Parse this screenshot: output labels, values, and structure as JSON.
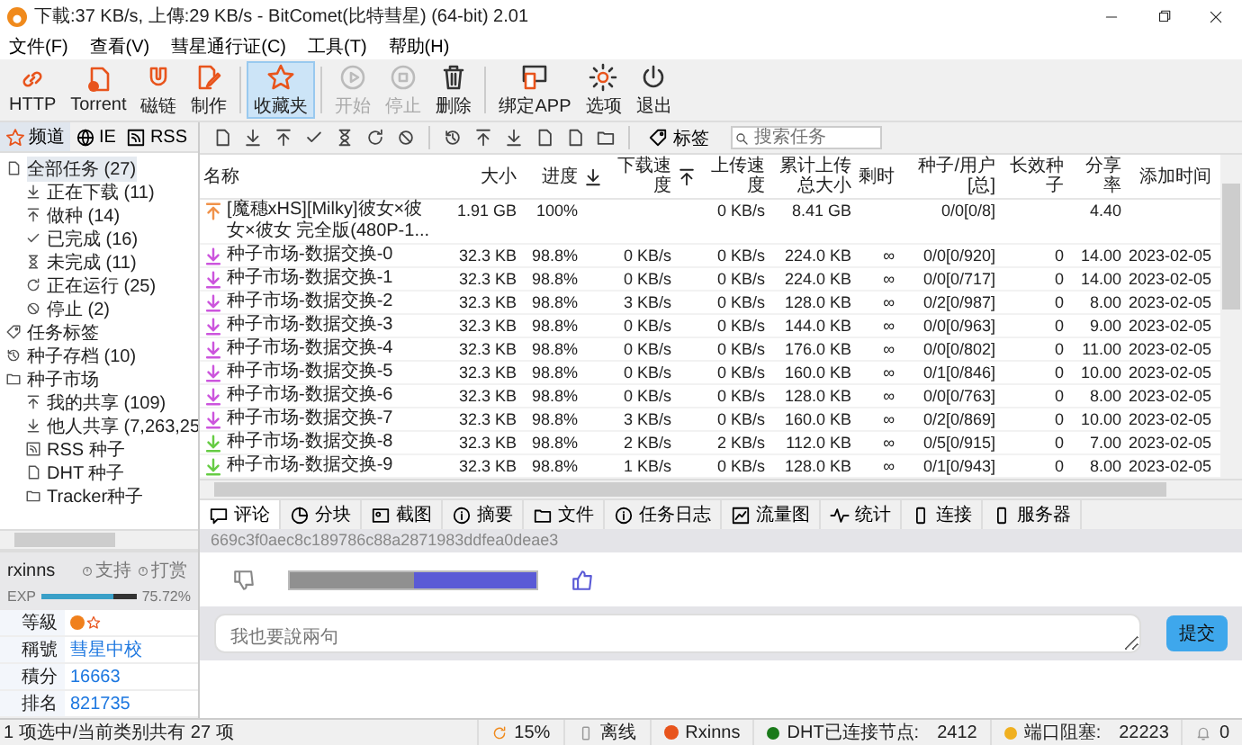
{
  "window": {
    "title": "下載:37 KB/s, 上傳:29 KB/s - BitComet(比特彗星) (64-bit) 2.01"
  },
  "menu": [
    "文件(F)",
    "查看(V)",
    "彗星通行证(C)",
    "工具(T)",
    "帮助(H)"
  ],
  "toolbar_groups": [
    [
      {
        "label": "HTTP",
        "selected": false,
        "disabled": false
      },
      {
        "label": "Torrent",
        "selected": false,
        "disabled": false
      },
      {
        "label": "磁链",
        "selected": false,
        "disabled": false
      },
      {
        "label": "制作",
        "selected": false,
        "disabled": false
      }
    ],
    [
      {
        "label": "收藏夹",
        "selected": true,
        "disabled": false
      }
    ],
    [
      {
        "label": "开始",
        "selected": false,
        "disabled": true
      },
      {
        "label": "停止",
        "selected": false,
        "disabled": true
      },
      {
        "label": "删除",
        "selected": false,
        "disabled": false
      }
    ],
    [
      {
        "label": "绑定APP",
        "selected": false,
        "disabled": false
      },
      {
        "label": "选项",
        "selected": false,
        "disabled": false
      },
      {
        "label": "退出",
        "selected": false,
        "disabled": false
      }
    ]
  ],
  "filter_bar": {
    "tag_button": "标签",
    "search": {
      "placeholder": "搜索任务"
    }
  },
  "sidebar": {
    "tabs": [
      {
        "label": "频道",
        "selected": true
      },
      {
        "label": "IE",
        "selected": false
      },
      {
        "label": "RSS",
        "selected": false
      }
    ],
    "tree": [
      {
        "label": "全部任务 (27)",
        "selected": true,
        "children": [
          {
            "label": "正在下载 (11)",
            "selected": false
          },
          {
            "label": "做种 (14)",
            "selected": false
          },
          {
            "label": "已完成 (16)",
            "selected": false
          },
          {
            "label": "未完成 (11)",
            "selected": false
          },
          {
            "label": "正在运行 (25)",
            "selected": false
          },
          {
            "label": "停止 (2)",
            "selected": false
          }
        ]
      },
      {
        "label": "任务标签",
        "selected": false
      },
      {
        "label": "种子存档 (10)",
        "selected": false
      },
      {
        "label": "种子市场",
        "selected": false,
        "children": [
          {
            "label": "我的共享 (109)",
            "selected": false
          },
          {
            "label": "他人共享 (7,263,25",
            "selected": false
          },
          {
            "label": "RSS 种子",
            "selected": false
          },
          {
            "label": "DHT 种子",
            "selected": false
          },
          {
            "label": "Tracker种子",
            "selected": false
          }
        ]
      }
    ]
  },
  "user": {
    "name": "rxinns",
    "links": [
      "支持",
      "打赏"
    ],
    "exp_label": "EXP",
    "exp": {
      "level": 0.7572,
      "reading": "75.72%"
    },
    "stats": [
      {
        "label": "等級",
        "kind": "badge"
      },
      {
        "label": "稱號",
        "kind": "text",
        "value": "彗星中校"
      },
      {
        "label": "積分",
        "kind": "text",
        "value": "16663"
      },
      {
        "label": "排名",
        "kind": "text",
        "value": "821735"
      }
    ]
  },
  "table": {
    "columns": [
      {
        "kind": "text",
        "label": "名称"
      },
      {
        "kind": "text",
        "label": "大小"
      },
      {
        "kind": "text",
        "label": "进度"
      },
      {
        "kind": "icon"
      },
      {
        "kind": "text",
        "label": "下载速度"
      },
      {
        "kind": "icon"
      },
      {
        "kind": "text",
        "label": "上传速度"
      },
      {
        "kind": "text",
        "label": "累计上传总大小"
      },
      {
        "kind": "text",
        "label": "剩时"
      },
      {
        "kind": "text",
        "label": "种子/用户[总]"
      },
      {
        "kind": "text",
        "label": "长效种子"
      },
      {
        "kind": "text",
        "label": "分享率"
      },
      {
        "kind": "text",
        "label": "添加时间"
      }
    ],
    "rows": [
      {
        "kind": "upload",
        "color": "#f0924a",
        "name": "[魔穗xHS][Milky]彼女×彼女×彼女 完全版(480P-1...",
        "size": "1.91 GB",
        "progress": "100%",
        "up_speed": "0 KB/s",
        "uploaded": "8.41 GB",
        "seeds_peers": "0/0[0/8]",
        "share_ratio": "4.40"
      },
      {
        "kind": "download",
        "color": "#cc55dd",
        "name": "种子市场-数据交换-0",
        "size": "32.3 KB",
        "progress": "98.8%",
        "down_speed": "0 KB/s",
        "up_speed": "0 KB/s",
        "uploaded": "224.0 KB",
        "time_left": "∞",
        "seeds_peers": "0/0[0/920]",
        "long_seeds": "0",
        "share_ratio": "14.00",
        "added": "2023-02-05"
      },
      {
        "kind": "download",
        "color": "#cc55dd",
        "name": "种子市场-数据交换-1",
        "size": "32.3 KB",
        "progress": "98.8%",
        "down_speed": "0 KB/s",
        "up_speed": "0 KB/s",
        "uploaded": "224.0 KB",
        "time_left": "∞",
        "seeds_peers": "0/0[0/717]",
        "long_seeds": "0",
        "share_ratio": "14.00",
        "added": "2023-02-05"
      },
      {
        "kind": "download",
        "color": "#cc55dd",
        "name": "种子市场-数据交换-2",
        "size": "32.3 KB",
        "progress": "98.8%",
        "down_speed": "3 KB/s",
        "up_speed": "0 KB/s",
        "uploaded": "128.0 KB",
        "time_left": "∞",
        "seeds_peers": "0/2[0/987]",
        "long_seeds": "0",
        "share_ratio": "8.00",
        "added": "2023-02-05"
      },
      {
        "kind": "download",
        "color": "#cc55dd",
        "name": "种子市场-数据交换-3",
        "size": "32.3 KB",
        "progress": "98.8%",
        "down_speed": "0 KB/s",
        "up_speed": "0 KB/s",
        "uploaded": "144.0 KB",
        "time_left": "∞",
        "seeds_peers": "0/0[0/963]",
        "long_seeds": "0",
        "share_ratio": "9.00",
        "added": "2023-02-05"
      },
      {
        "kind": "download",
        "color": "#cc55dd",
        "name": "种子市场-数据交换-4",
        "size": "32.3 KB",
        "progress": "98.8%",
        "down_speed": "0 KB/s",
        "up_speed": "0 KB/s",
        "uploaded": "176.0 KB",
        "time_left": "∞",
        "seeds_peers": "0/0[0/802]",
        "long_seeds": "0",
        "share_ratio": "11.00",
        "added": "2023-02-05"
      },
      {
        "kind": "download",
        "color": "#cc55dd",
        "name": "种子市场-数据交换-5",
        "size": "32.3 KB",
        "progress": "98.8%",
        "down_speed": "0 KB/s",
        "up_speed": "0 KB/s",
        "uploaded": "160.0 KB",
        "time_left": "∞",
        "seeds_peers": "0/1[0/846]",
        "long_seeds": "0",
        "share_ratio": "10.00",
        "added": "2023-02-05"
      },
      {
        "kind": "download",
        "color": "#cc55dd",
        "name": "种子市场-数据交换-6",
        "size": "32.3 KB",
        "progress": "98.8%",
        "down_speed": "0 KB/s",
        "up_speed": "0 KB/s",
        "uploaded": "128.0 KB",
        "time_left": "∞",
        "seeds_peers": "0/0[0/763]",
        "long_seeds": "0",
        "share_ratio": "8.00",
        "added": "2023-02-05"
      },
      {
        "kind": "download",
        "color": "#cc55dd",
        "name": "种子市场-数据交换-7",
        "size": "32.3 KB",
        "progress": "98.8%",
        "down_speed": "3 KB/s",
        "up_speed": "0 KB/s",
        "uploaded": "160.0 KB",
        "time_left": "∞",
        "seeds_peers": "0/2[0/869]",
        "long_seeds": "0",
        "share_ratio": "10.00",
        "added": "2023-02-05"
      },
      {
        "kind": "download",
        "color": "#66cc44",
        "name": "种子市场-数据交换-8",
        "size": "32.3 KB",
        "progress": "98.8%",
        "down_speed": "2 KB/s",
        "up_speed": "2 KB/s",
        "uploaded": "112.0 KB",
        "time_left": "∞",
        "seeds_peers": "0/5[0/915]",
        "long_seeds": "0",
        "share_ratio": "7.00",
        "added": "2023-02-05"
      },
      {
        "kind": "download",
        "color": "#66cc44",
        "name": "种子市场-数据交换-9",
        "size": "32.3 KB",
        "progress": "98.8%",
        "down_speed": "1 KB/s",
        "up_speed": "0 KB/s",
        "uploaded": "128.0 KB",
        "time_left": "∞",
        "seeds_peers": "0/1[0/943]",
        "long_seeds": "0",
        "share_ratio": "8.00",
        "added": "2023-02-05"
      }
    ]
  },
  "details": {
    "tabs": [
      {
        "label": "评论",
        "selected": true
      },
      {
        "label": "分块",
        "selected": false
      },
      {
        "label": "截图",
        "selected": false
      },
      {
        "label": "摘要",
        "selected": false
      },
      {
        "label": "文件",
        "selected": false
      },
      {
        "label": "任务日志",
        "selected": false
      },
      {
        "label": "流量图",
        "selected": false
      },
      {
        "label": "统计",
        "selected": false
      },
      {
        "label": "连接",
        "selected": false
      },
      {
        "label": "服务器",
        "selected": false
      }
    ],
    "hash": "669c3f0aec8c189786c88a2871983ddfea0deae3",
    "rating": {
      "level": 0.5
    },
    "comment": {
      "placeholder": "我也要說兩句"
    },
    "submit": "提交"
  },
  "status_bar": [
    {
      "kind": "text",
      "text": "1 项选中/当前类别共有 27 项"
    },
    {
      "kind": "icon",
      "text": "15%"
    },
    {
      "kind": "icon",
      "text": "离线"
    },
    {
      "kind": "avatar",
      "text": "Rxinns"
    },
    {
      "kind": "dot",
      "color": "#1a7a1a",
      "text": "DHT已连接节点:",
      "value": "2412"
    },
    {
      "kind": "dot",
      "color": "#f0b020",
      "text": "端口阻塞:",
      "value": "22223"
    },
    {
      "kind": "icon",
      "text": "0"
    }
  ]
}
